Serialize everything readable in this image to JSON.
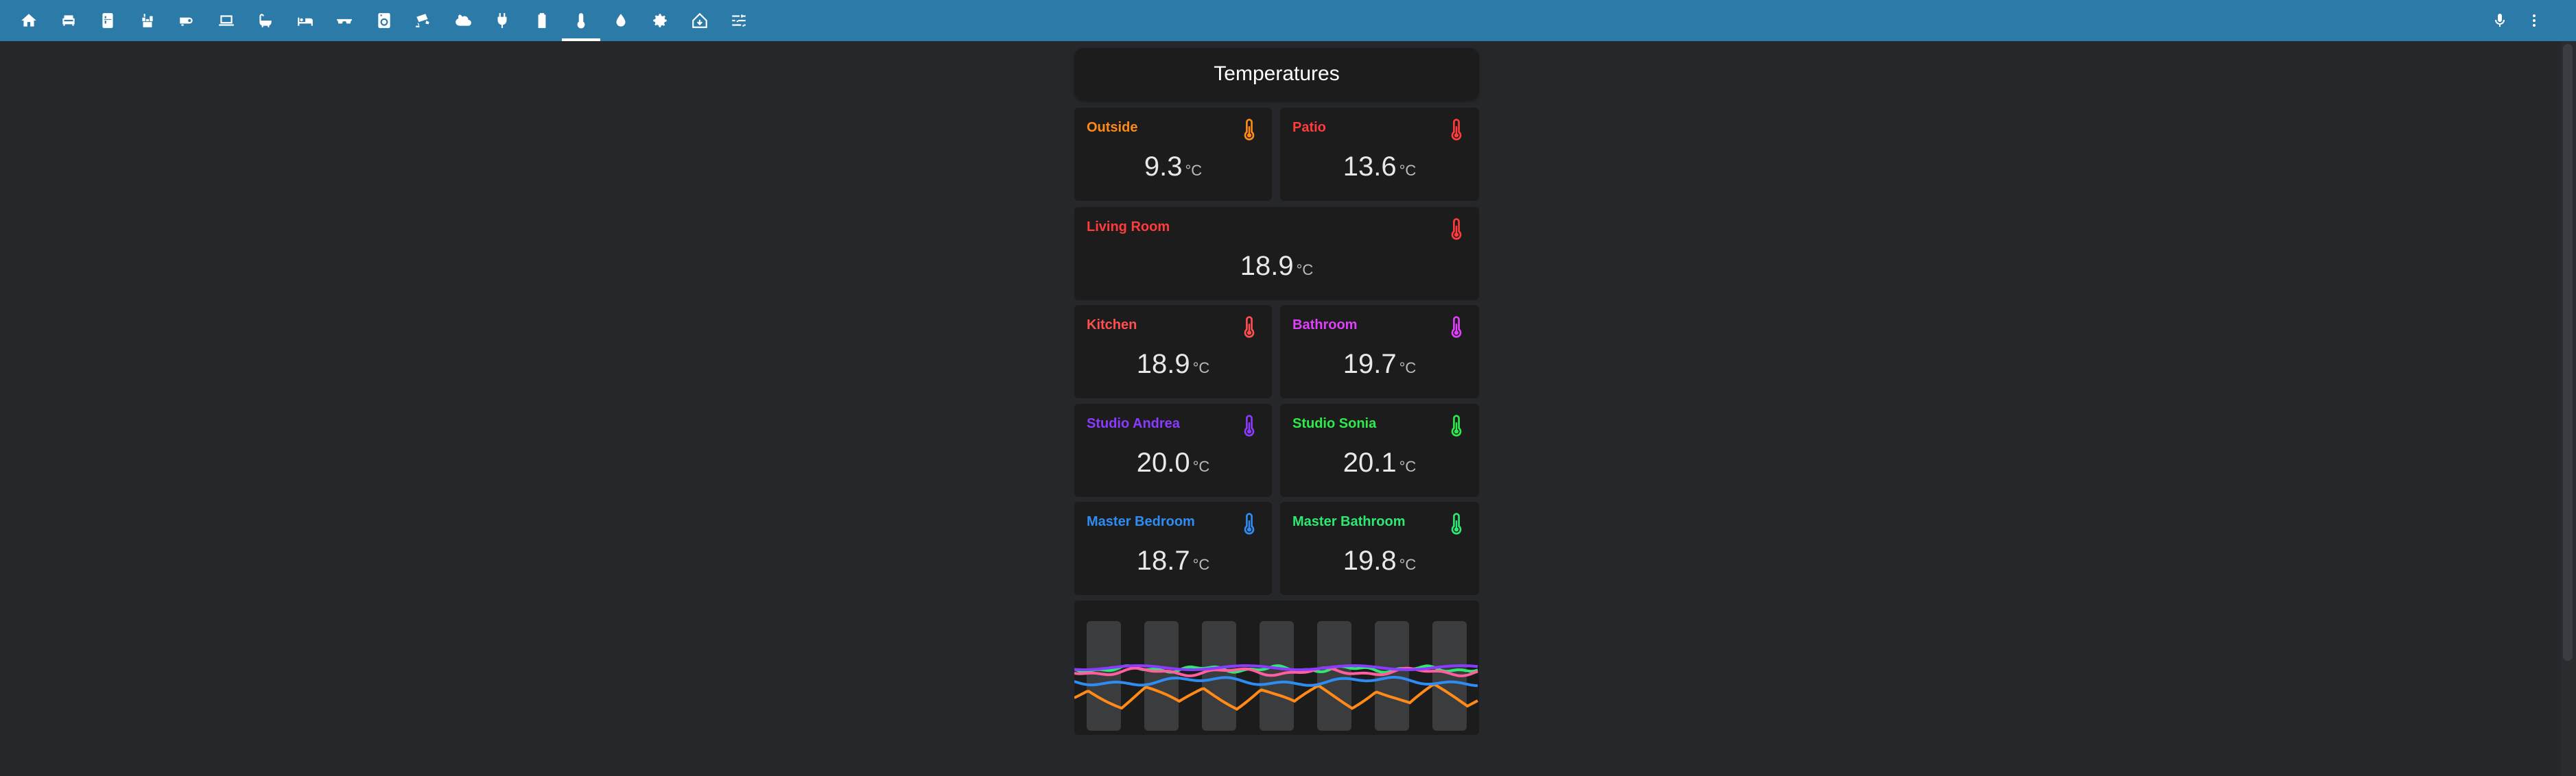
{
  "toolbar": {
    "tabs": [
      {
        "name": "home",
        "icon": "home-icon"
      },
      {
        "name": "living",
        "icon": "sofa-icon"
      },
      {
        "name": "fridge",
        "icon": "fridge-icon"
      },
      {
        "name": "kitchen",
        "icon": "stove-icon"
      },
      {
        "name": "projector",
        "icon": "projector-icon"
      },
      {
        "name": "computer",
        "icon": "laptop-icon"
      },
      {
        "name": "bath",
        "icon": "bathtub-icon"
      },
      {
        "name": "bedroom",
        "icon": "bed-icon"
      },
      {
        "name": "glasses",
        "icon": "glasses-icon"
      },
      {
        "name": "washer",
        "icon": "washing-machine-icon"
      },
      {
        "name": "security",
        "icon": "cctv-icon"
      },
      {
        "name": "weather",
        "icon": "weather-icon"
      },
      {
        "name": "power",
        "icon": "plug-icon"
      },
      {
        "name": "battery",
        "icon": "battery-icon"
      },
      {
        "name": "temperatures",
        "icon": "thermometer-icon",
        "active": true
      },
      {
        "name": "water",
        "icon": "water-drop-icon"
      },
      {
        "name": "settings",
        "icon": "gear-icon"
      },
      {
        "name": "home-assistant",
        "icon": "home-assistant-icon"
      },
      {
        "name": "controls",
        "icon": "sliders-icon"
      }
    ],
    "right": [
      {
        "name": "voice",
        "icon": "microphone-icon"
      },
      {
        "name": "menu",
        "icon": "dots-vertical-icon"
      }
    ],
    "bg_color": "#2b7aa8"
  },
  "title": "Temperatures",
  "unit": "°C",
  "sensors": [
    {
      "name": "Outside",
      "value": "9.3",
      "color": "#ff8a17"
    },
    {
      "name": "Patio",
      "value": "13.6",
      "color": "#ff3b3b"
    },
    {
      "name": "Living Room",
      "value": "18.9",
      "color": "#ff3b3b"
    },
    {
      "name": "Kitchen",
      "value": "18.9",
      "color": "#ff4f4f"
    },
    {
      "name": "Bathroom",
      "value": "19.7",
      "color": "#e040fb"
    },
    {
      "name": "Studio Andrea",
      "value": "20.0",
      "color": "#8a3bff"
    },
    {
      "name": "Studio Sonia",
      "value": "20.1",
      "color": "#2eea4c"
    },
    {
      "name": "Master Bedroom",
      "value": "18.7",
      "color": "#2f8cf3"
    },
    {
      "name": "Master Bathroom",
      "value": "19.8",
      "color": "#2ee872"
    }
  ],
  "graph": {
    "series_colors": [
      "#ff8a17",
      "#2f8cf3",
      "#2ee872",
      "#ff5f9e",
      "#8a3bff"
    ]
  }
}
